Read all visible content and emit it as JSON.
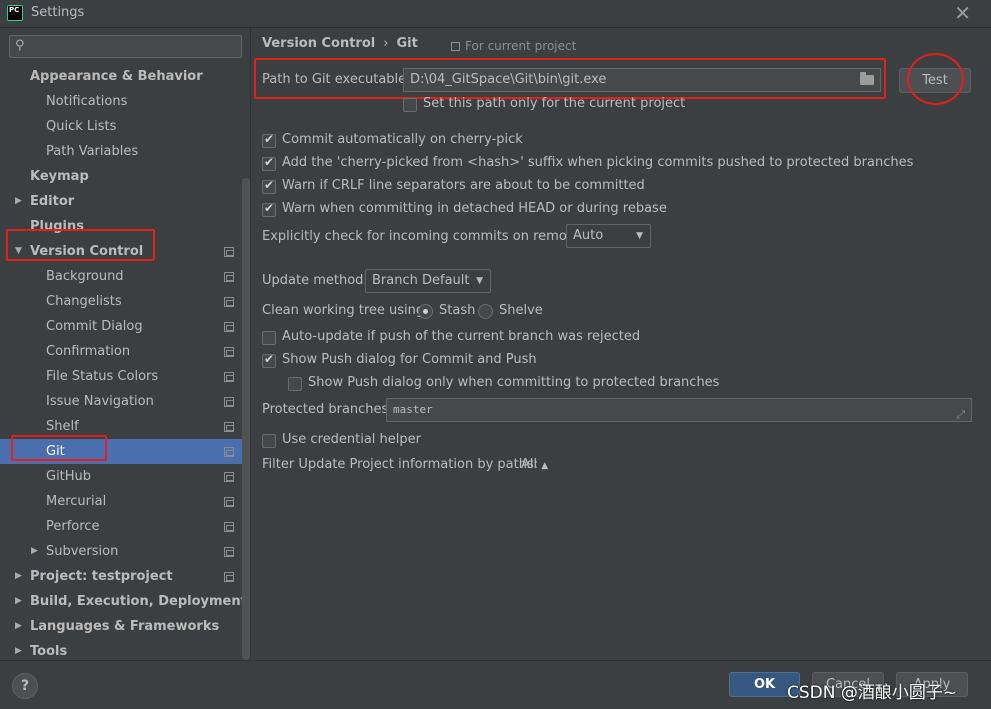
{
  "window": {
    "title": "Settings",
    "app_icon_text": "PC",
    "close_glyph": "✕"
  },
  "search": {
    "placeholder": "",
    "icon": "search-icon"
  },
  "sidebar": {
    "items": [
      {
        "label": "Appearance & Behavior",
        "level": 0,
        "bold": true,
        "arrow": ""
      },
      {
        "label": "Notifications",
        "level": 1
      },
      {
        "label": "Quick Lists",
        "level": 1
      },
      {
        "label": "Path Variables",
        "level": 1
      },
      {
        "label": "Keymap",
        "level": 0,
        "bold": true
      },
      {
        "label": "Editor",
        "level": 0,
        "bold": true,
        "arrow": "▶"
      },
      {
        "label": "Plugins",
        "level": 0,
        "bold": true
      },
      {
        "label": "Version Control",
        "level": 0,
        "bold": true,
        "arrow": "▼"
      },
      {
        "label": "Background",
        "level": 1
      },
      {
        "label": "Changelists",
        "level": 1
      },
      {
        "label": "Commit Dialog",
        "level": 1
      },
      {
        "label": "Confirmation",
        "level": 1
      },
      {
        "label": "File Status Colors",
        "level": 1
      },
      {
        "label": "Issue Navigation",
        "level": 1
      },
      {
        "label": "Shelf",
        "level": 1
      },
      {
        "label": "Git",
        "level": 1,
        "selected": true
      },
      {
        "label": "GitHub",
        "level": 1
      },
      {
        "label": "Mercurial",
        "level": 1
      },
      {
        "label": "Perforce",
        "level": 1
      },
      {
        "label": "Subversion",
        "level": 1,
        "arrow": "▶"
      },
      {
        "label": "Project: testproject",
        "level": 0,
        "bold": true,
        "arrow": "▶"
      },
      {
        "label": "Build, Execution, Deployment",
        "level": 0,
        "bold": true,
        "arrow": "▶"
      },
      {
        "label": "Languages & Frameworks",
        "level": 0,
        "bold": true,
        "arrow": "▶"
      },
      {
        "label": "Tools",
        "level": 0,
        "bold": true,
        "arrow": "▶"
      }
    ]
  },
  "breadcrumb": {
    "parent": "Version Control",
    "separator": "›",
    "current": "Git",
    "scope_note": "For current project"
  },
  "git_path": {
    "label": "Path to Git executable:",
    "value": "D:\\04_GitSpace\\Git\\bin\\git.exe",
    "test_button": "Test",
    "current_project_only": "Set this path only for the current project"
  },
  "options": {
    "cherry_pick_commit": "Commit automatically on cherry-pick",
    "cherry_pick_suffix": "Add the 'cherry-picked from <hash>' suffix when picking commits pushed to protected branches",
    "warn_crlf": "Warn if CRLF line separators are about to be committed",
    "warn_detached": "Warn when committing in detached HEAD or during rebase",
    "incoming_check_label": "Explicitly check for incoming commits on remotes:",
    "incoming_check_value": "Auto",
    "update_method_label": "Update method:",
    "update_method_value": "Branch Default",
    "clean_tree_label": "Clean working tree using:",
    "stash_label": "Stash",
    "shelve_label": "Shelve",
    "auto_update": "Auto-update if push of the current branch was rejected",
    "show_push_dialog": "Show Push dialog for Commit and Push",
    "show_push_protected": "Show Push dialog only when committing to protected branches",
    "protected_branches_label": "Protected branches:",
    "protected_branches_value": "master",
    "credential_helper": "Use credential helper",
    "filter_label": "Filter Update Project information by paths:",
    "filter_value": "All"
  },
  "footer": {
    "help": "?",
    "ok": "OK",
    "cancel": "Cancel",
    "apply": "Apply"
  },
  "watermark": "CSDN @酒酿小圆子~",
  "colors": {
    "background": "#3c3f41",
    "selection": "#4b6eaf",
    "annotation": "#e0201c",
    "primary_button": "#365880"
  }
}
